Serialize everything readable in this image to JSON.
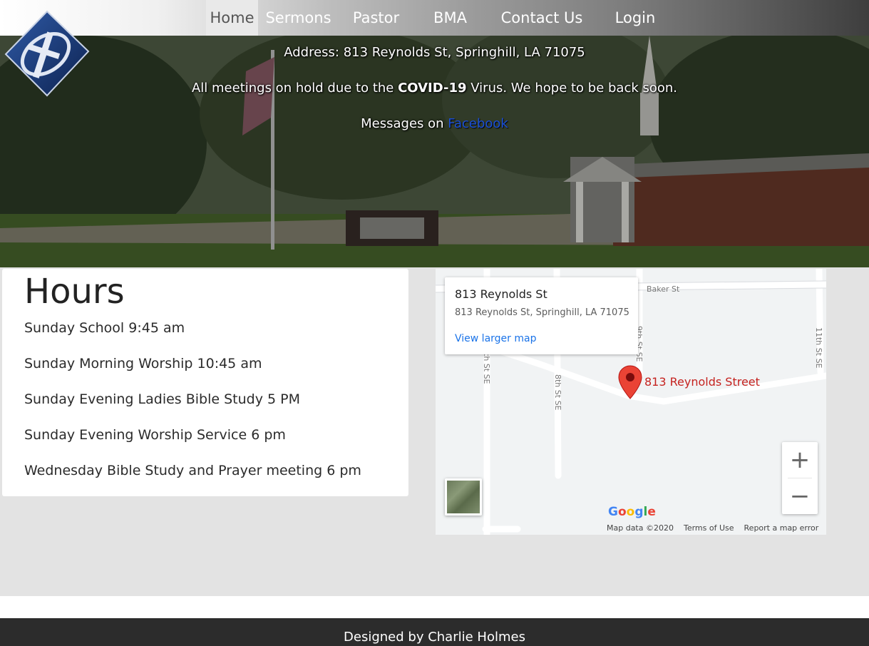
{
  "nav": {
    "items": [
      {
        "label": "Home",
        "active": true
      },
      {
        "label": "Sermons",
        "active": false
      },
      {
        "label": "Pastor",
        "active": false
      },
      {
        "label": "BMA",
        "active": false
      },
      {
        "label": "Contact Us",
        "active": false
      },
      {
        "label": "Login",
        "active": false
      }
    ]
  },
  "logo": {
    "icon": "church-cross-logo-icon"
  },
  "hero": {
    "address": "Address: 813 Reynolds St, Springhill, LA 71075",
    "notice_prefix": "All meetings on hold due to the ",
    "notice_bold": "COVID-19",
    "notice_suffix": " Virus. We hope to be back soon.",
    "messages_prefix": "Messages on ",
    "facebook_link": "Facebook"
  },
  "hours": {
    "title": "Hours",
    "items": [
      "Sunday School 9:45 am",
      "Sunday Morning Worship 10:45 am",
      "Sunday Evening Ladies Bible Study 5 PM",
      "Sunday Evening Worship Service 6 pm",
      "Wednesday Bible Study and Prayer meeting 6 pm"
    ]
  },
  "map": {
    "info_title": "813 Reynolds St",
    "info_address": "813 Reynolds St, Springhill, LA 71075",
    "view_larger": "View larger map",
    "pin_label": "813 Reynolds Street",
    "streets": [
      "Baker St",
      "9th St SE",
      "8th St SE",
      "11th St SE",
      "th St SE"
    ],
    "zoom_in": "+",
    "zoom_out": "−",
    "google": "Google",
    "map_data": "Map data ©2020",
    "terms": "Terms of Use",
    "report": "Report a map error",
    "pin_color": "#ea4335"
  },
  "footer": {
    "text": "Designed by Charlie Holmes"
  }
}
